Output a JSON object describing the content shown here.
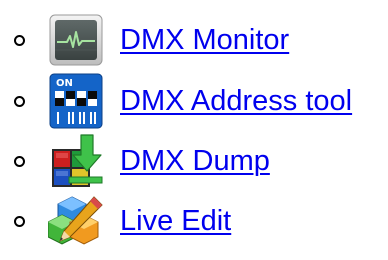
{
  "tools": [
    {
      "label": "DMX Monitor",
      "icon": "dmx-monitor-icon"
    },
    {
      "label": "DMX Address tool",
      "icon": "dip-switch-icon",
      "icon_text": "ON"
    },
    {
      "label": "DMX Dump",
      "icon": "dmx-dump-icon"
    },
    {
      "label": "Live Edit",
      "icon": "live-edit-icon"
    }
  ],
  "colors": {
    "link": "#0000ee",
    "monitor_screen": "#4b5554",
    "monitor_trace": "#a6e3a0",
    "dip_switch_body": "#1464c8",
    "dump_arrow": "#3fc24a"
  }
}
